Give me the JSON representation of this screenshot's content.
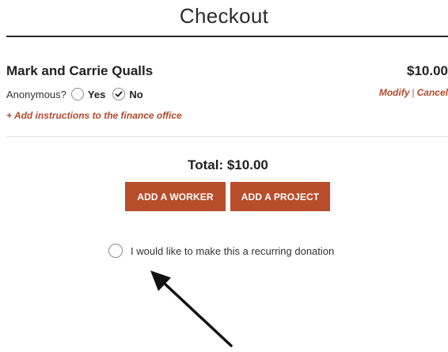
{
  "page": {
    "title": "Checkout"
  },
  "item": {
    "name": "Mark and Carrie Qualls",
    "price": "$10.00",
    "anonymous_label": "Anonymous?",
    "option_yes": "Yes",
    "option_no": "No",
    "selected_option": "No",
    "modify_label": "Modify",
    "separator": "|",
    "cancel_label": "Cancel",
    "add_instructions": "+ Add instructions to the finance office"
  },
  "summary": {
    "total": "Total: $10.00"
  },
  "buttons": {
    "add_worker": "ADD A WORKER",
    "add_project": "ADD A PROJECT"
  },
  "recurring": {
    "label": "I would like to make this a recurring donation",
    "checked": false
  },
  "colors": {
    "accent": "#b84d2c",
    "link": "#b24a2b",
    "text": "#222222"
  },
  "icons": {
    "selected_radio": "checkmark-icon",
    "annotation": "arrow-icon"
  }
}
